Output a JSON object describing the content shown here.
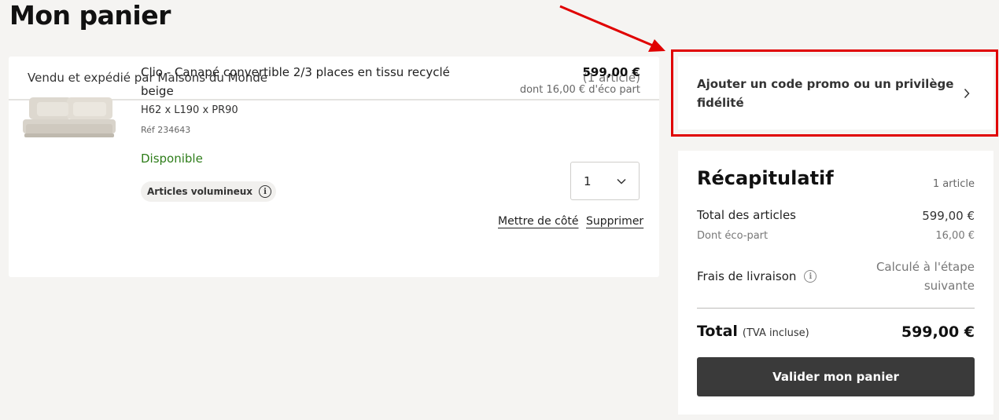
{
  "page": {
    "title": "Mon panier"
  },
  "cart": {
    "seller": "Vendu et expédié par Maisons du Monde",
    "count": "(1 article)",
    "item": {
      "name": "Clio - Canapé convertible 2/3 places en tissu recyclé beige",
      "dimensions": "H62 x L190 x PR90",
      "reference": "Réf 234643",
      "availability": "Disponible",
      "badge": "Articles volumineux",
      "price": "599,00 €",
      "eco_part": "dont 16,00 € d'éco part",
      "quantity": "1",
      "set_aside": "Mettre de côté",
      "remove": "Supprimer"
    }
  },
  "promo": {
    "label": "Ajouter un code promo ou un privilège fidélité"
  },
  "summary": {
    "title": "Récapitulatif",
    "count": "1 article",
    "items_total_label": "Total des articles",
    "items_total_value": "599,00 €",
    "eco_label": "Dont éco-part",
    "eco_value": "16,00 €",
    "shipping_label": "Frais de livraison",
    "shipping_value": "Calculé à l'étape suivante",
    "total_label": "Total",
    "total_note": "(TVA incluse)",
    "total_value": "599,00 €",
    "cta": "Valider mon panier"
  },
  "colors": {
    "availability": "#2e7d1a",
    "highlight": "#e00000",
    "cta_background": "#3a3a3a",
    "page_background": "#f5f4f2"
  }
}
